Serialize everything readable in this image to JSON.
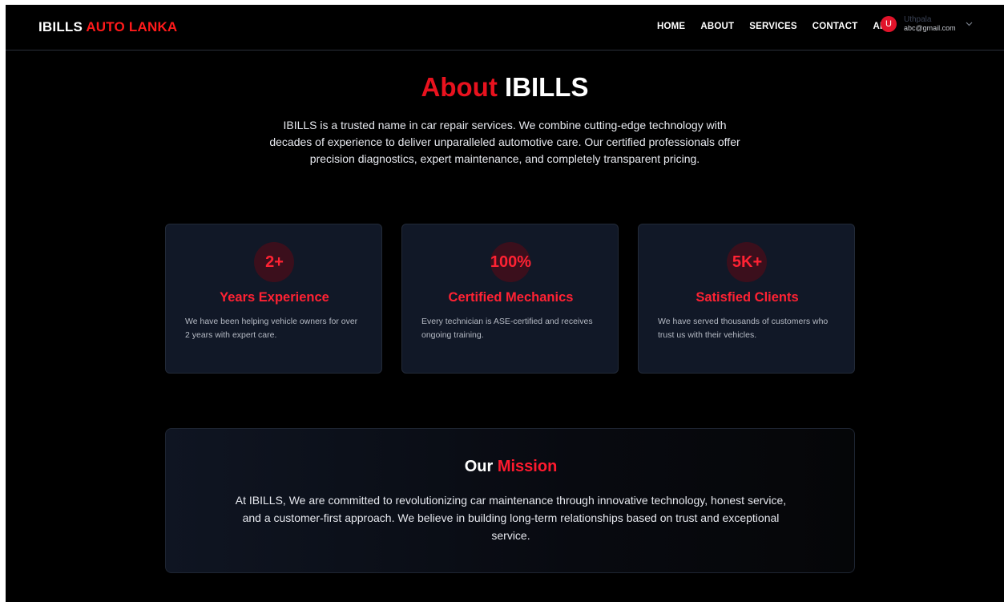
{
  "brand": {
    "part1": "IBILLS",
    "part2": "AUTO LANKA"
  },
  "nav": {
    "items": [
      {
        "label": "HOME"
      },
      {
        "label": "ABOUT"
      },
      {
        "label": "SERVICES"
      },
      {
        "label": "CONTACT"
      },
      {
        "label": "AI"
      }
    ]
  },
  "user": {
    "initial": "U",
    "name": "Uthpala",
    "email": "abc@gmail.com",
    "menu_icon": "chevron-down-icon"
  },
  "hero": {
    "title_part1": "About",
    "title_part2": "IBILLS",
    "intro": "IBILLS is a trusted name in car repair services. We combine cutting-edge technology with decades of experience to deliver unparalleled automotive care. Our certified professionals offer precision diagnostics, expert maintenance, and completely transparent pricing."
  },
  "stats": [
    {
      "value": "2+",
      "title": "Years Experience",
      "desc": "We have been helping vehicle owners for over 2 years with expert care."
    },
    {
      "value": "100%",
      "title": "Certified Mechanics",
      "desc": "Every technician is ASE-certified and receives ongoing training."
    },
    {
      "value": "5K+",
      "title": "Satisfied Clients",
      "desc": "We have served thousands of customers who trust us with their vehicles."
    }
  ],
  "mission": {
    "title_part1": "Our",
    "title_part2": "Mission",
    "text": "At IBILLS, We are committed to revolutionizing car maintenance through innovative technology, honest service, and a customer-first approach. We believe in building long-term relationships based on trust and exceptional service."
  },
  "colors": {
    "accent": "#e8121e",
    "background": "#000000",
    "card": "#111827"
  }
}
